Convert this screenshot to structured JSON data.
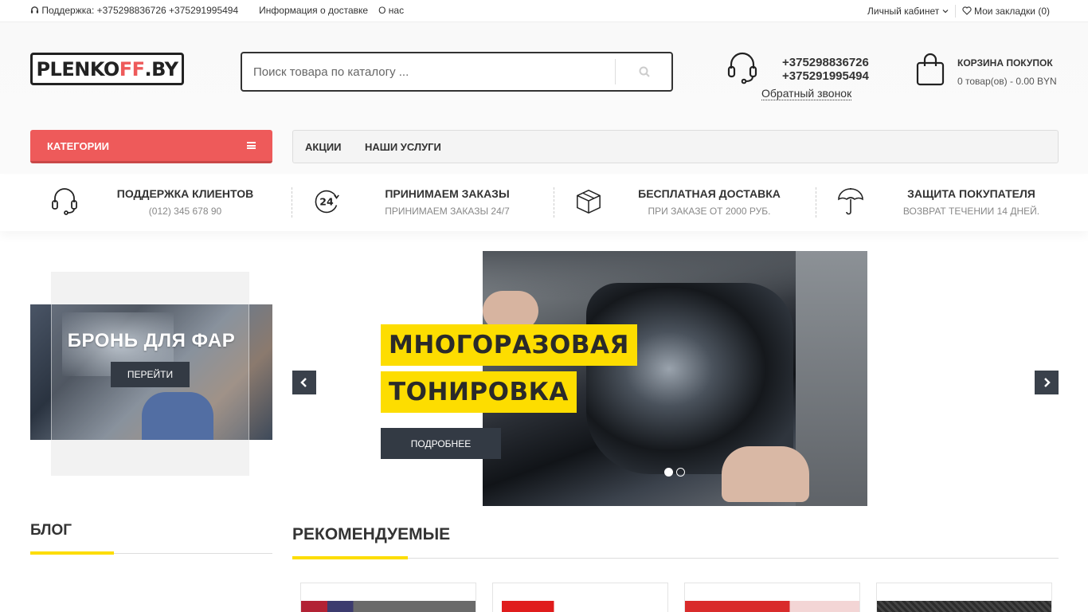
{
  "topbar": {
    "support": "Поддержка: +375298836726 +375291995494",
    "delivery": "Информация о доставке",
    "about": "О нас",
    "account": "Личный кабинет",
    "bookmarks": "Мои закладки (0)"
  },
  "header": {
    "logo": {
      "part1": "PLENKO",
      "part2": "FF",
      "part3": ".BY"
    },
    "search_placeholder": "Поиск товара по каталогу ...",
    "phone1": "+375298836726",
    "phone2": "+375291995494",
    "callback": "Обратный звонок",
    "cart_title": "КОРЗИНА ПОКУПОК",
    "cart_summary": "0 товар(ов) - 0.00 BYN"
  },
  "nav": {
    "categories": "КАТЕГОРИИ",
    "items": [
      "АКЦИИ",
      "НАШИ УСЛУГИ"
    ]
  },
  "features": [
    {
      "icon": "headset-icon",
      "title": "ПОДДЕРЖКА КЛИЕНТОВ",
      "subtitle": "(012) 345 678 90"
    },
    {
      "icon": "24-hours-icon",
      "title": "ПРИНИМАЕМ ЗАКАЗЫ",
      "subtitle": "ПРИНИМАЕМ ЗАКАЗЫ 24/7"
    },
    {
      "icon": "box-icon",
      "title": "БЕСПЛАТНАЯ ДОСТАВКА",
      "subtitle": "ПРИ ЗАКАЗЕ ОТ 2000 РУБ."
    },
    {
      "icon": "umbrella-icon",
      "title": "ЗАЩИТА ПОКУПАТЕЛЯ",
      "subtitle": "ВОЗВРАТ ТЕЧЕНИИ 14 ДНЕЙ."
    }
  ],
  "promo": {
    "title": "БРОНЬ ДЛЯ ФАР",
    "button": "ПЕРЕЙТИ"
  },
  "slider": {
    "line1": "МНОГОРАЗОВАЯ",
    "line2": "ТОНИРОВКА",
    "button": "ПОДРОБНЕЕ",
    "active_slide": 1,
    "total_slides": 2
  },
  "sections": {
    "blog": "БЛОГ",
    "recommended": "РЕКОМЕНДУЕМЫЕ"
  },
  "colors": {
    "accent": "#ee5a5a",
    "highlight": "#fddd00",
    "dark": "#333a44"
  }
}
